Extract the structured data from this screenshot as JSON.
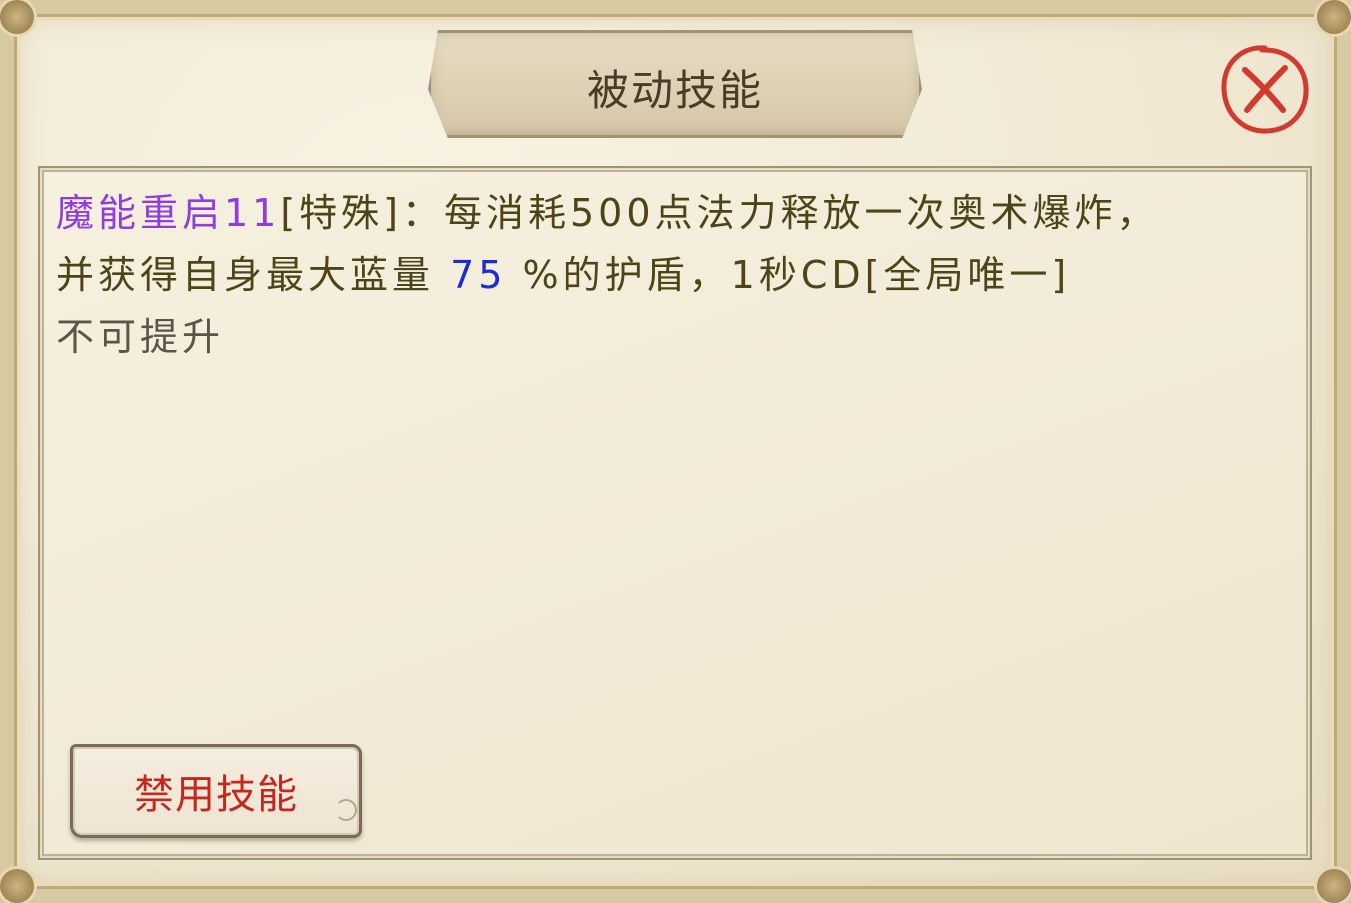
{
  "dialog": {
    "title": "被动技能"
  },
  "skill": {
    "name": "魔能重启11",
    "desc_part1": "[特殊]：每消耗500点法力释放一次奥术爆炸，",
    "desc_part2_prefix": "并获得自身最大蓝量 ",
    "shield_value": "75",
    "desc_part2_suffix": " %的护盾，1秒CD[全局唯一]",
    "upgrade_status": "不可提升"
  },
  "buttons": {
    "disable_label": "禁用技能",
    "close_icon": "close-icon"
  },
  "colors": {
    "skill_name": "#8f3ce0",
    "value": "#1b2bd6",
    "body_text": "#4e4418",
    "button_text": "#c5261e",
    "close_stroke": "#d23a2e"
  }
}
